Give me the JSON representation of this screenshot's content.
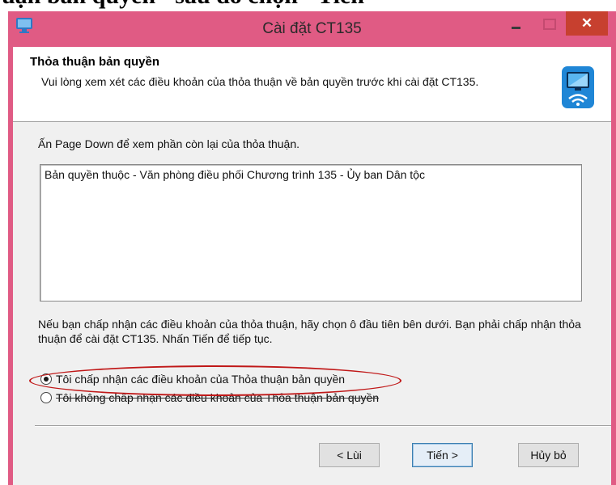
{
  "caption": "uận bản quyền\" sau đó chọn \"Tiến\"",
  "window": {
    "title": "Cài đặt CT135",
    "close_glyph": "✕"
  },
  "header": {
    "title": "Thỏa thuận bản quyền",
    "description": "Vui lòng xem xét các điều khoản của thỏa thuận về bản quyền trước khi cài đặt CT135.",
    "icon": "monitor-wifi-icon"
  },
  "body": {
    "instruction": "Ấn Page Down để xem phần còn lại của thỏa thuận.",
    "license_text": "Bản quyền thuộc - Văn phòng điều phối Chương trình 135 - Ủy ban Dân tộc",
    "accept_note": "Nếu bạn chấp nhận các điều khoản của thỏa thuận, hãy chọn ô đầu tiên bên dưới. Bạn phải chấp nhận thỏa thuận để cài đặt CT135. Nhấn Tiến để tiếp tục."
  },
  "options": {
    "accept": {
      "label": "Tôi chấp nhận các điều khoản của Thỏa thuận bản quyền",
      "selected": true
    },
    "decline": {
      "label": "Tôi không chấp nhận các điều khoản của Thỏa thuận bản quyền",
      "selected": false
    }
  },
  "buttons": {
    "back": "< Lùi",
    "next": "Tiến >",
    "cancel": "Hủy bỏ"
  },
  "colors": {
    "window_frame": "#e05b84",
    "close_button": "#c7402f",
    "highlight": "#c01818",
    "default_button_border": "#3c7fb1"
  }
}
